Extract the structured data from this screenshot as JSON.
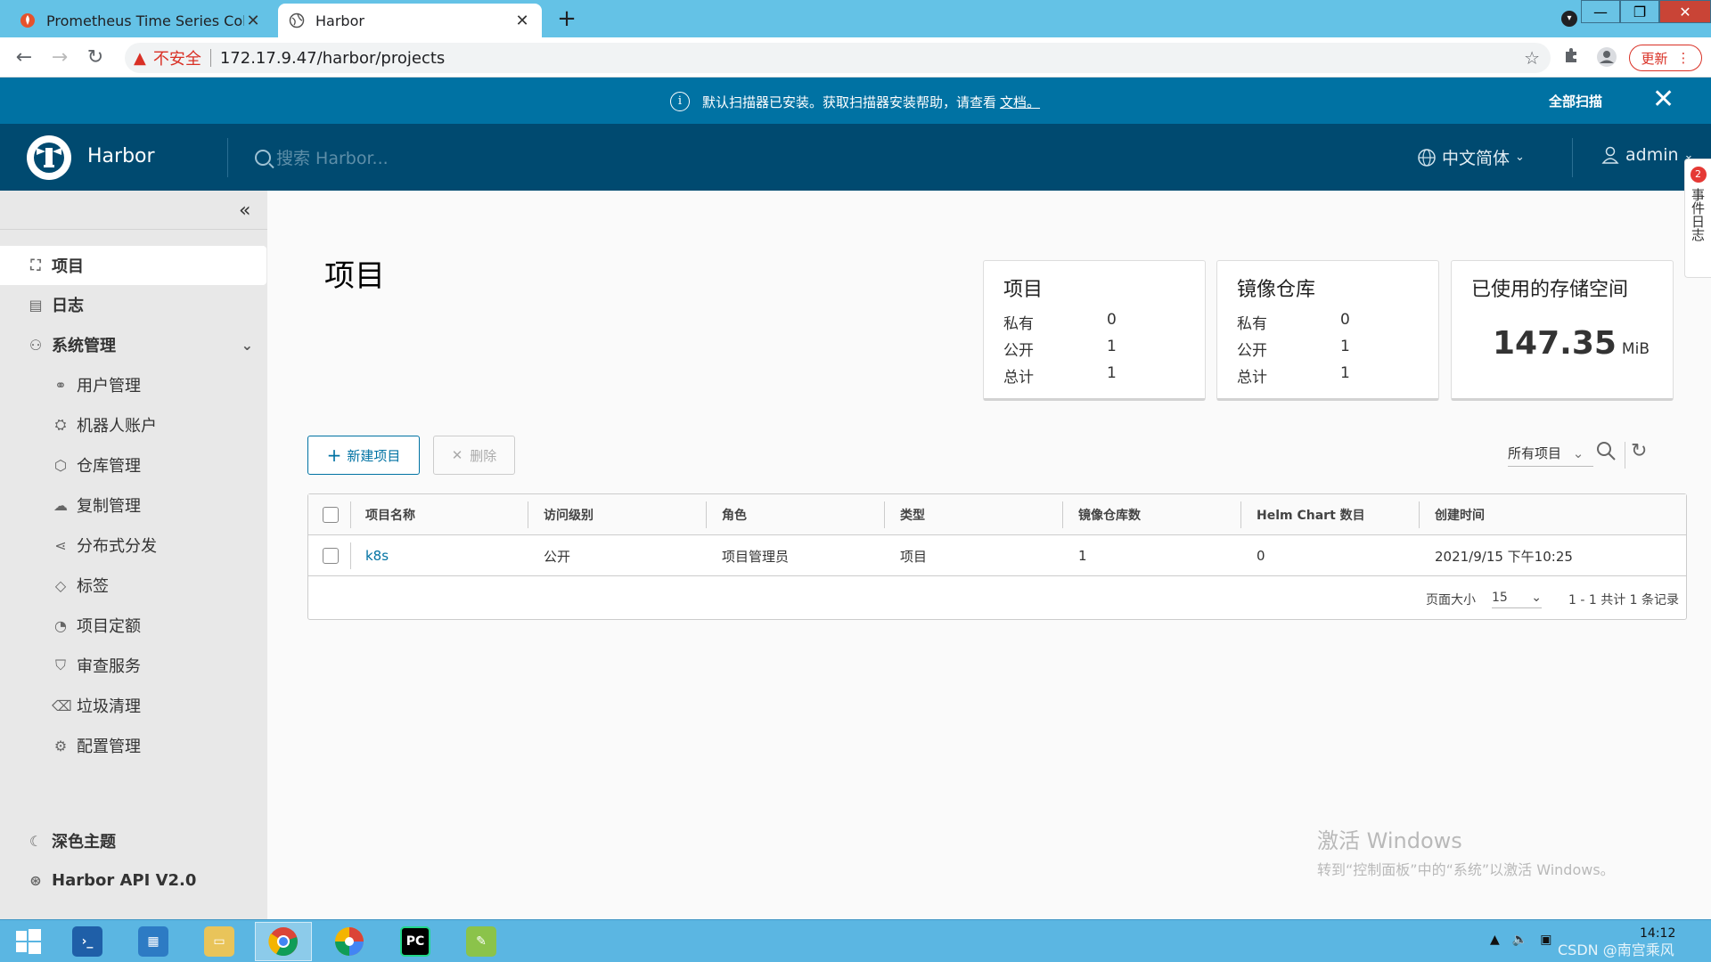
{
  "browser": {
    "tabs": [
      {
        "title": "Prometheus Time Series Colle",
        "active": false,
        "favicon": "prometheus-flame-icon"
      },
      {
        "title": "Harbor",
        "active": true,
        "favicon": "globe-icon"
      }
    ],
    "insecure_label": "不安全",
    "url": "172.17.9.47/harbor/projects",
    "update_label": "更新"
  },
  "banner": {
    "message": "默认扫描器已安装。获取扫描器安装帮助，请查看",
    "link": "文档。",
    "scan_all": "全部扫描"
  },
  "header": {
    "brand": "Harbor",
    "search_placeholder": "搜索 Harbor...",
    "language": "中文简体",
    "user": "admin"
  },
  "sidebar": {
    "items": [
      {
        "label": "项目",
        "icon": "projects-icon",
        "active": true
      },
      {
        "label": "日志",
        "icon": "logs-icon"
      },
      {
        "label": "系统管理",
        "icon": "admin-icon"
      },
      {
        "label": "用户管理",
        "icon": "users-icon"
      },
      {
        "label": "机器人账户",
        "icon": "robot-icon"
      },
      {
        "label": "仓库管理",
        "icon": "registry-icon"
      },
      {
        "label": "复制管理",
        "icon": "replication-icon"
      },
      {
        "label": "分布式分发",
        "icon": "distribution-icon"
      },
      {
        "label": "标签",
        "icon": "tag-icon"
      },
      {
        "label": "项目定额",
        "icon": "quota-icon"
      },
      {
        "label": "审查服务",
        "icon": "interrogation-icon"
      },
      {
        "label": "垃圾清理",
        "icon": "trash-icon"
      },
      {
        "label": "配置管理",
        "icon": "config-gear-icon"
      }
    ],
    "dark_theme": "深色主题",
    "api": "Harbor API V2.0"
  },
  "main": {
    "title": "项目",
    "cards": {
      "projects": {
        "title": "项目",
        "rows": [
          {
            "k": "私有",
            "v": "0"
          },
          {
            "k": "公开",
            "v": "1"
          },
          {
            "k": "总计",
            "v": "1"
          }
        ]
      },
      "repos": {
        "title": "镜像仓库",
        "rows": [
          {
            "k": "私有",
            "v": "0"
          },
          {
            "k": "公开",
            "v": "1"
          },
          {
            "k": "总计",
            "v": "1"
          }
        ]
      },
      "storage": {
        "title": "已使用的存储空间",
        "value": "147.35",
        "unit": "MiB"
      }
    },
    "new_project": "新建项目",
    "delete": "删除",
    "filter": "所有项目",
    "table": {
      "headers": [
        "项目名称",
        "访问级别",
        "角色",
        "类型",
        "镜像仓库数",
        "Helm Chart 数目",
        "创建时间"
      ],
      "rows": [
        [
          "k8s",
          "公开",
          "项目管理员",
          "项目",
          "1",
          "0",
          "2021/9/15 下午10:25"
        ]
      ]
    },
    "page_size_label": "页面大小",
    "page_size": "15",
    "page_info": "1 - 1 共计 1 条记录"
  },
  "float_tab": {
    "badge": "2",
    "label": "事件日志"
  },
  "watermark": {
    "line1": "激活 Windows",
    "line2": "转到“控制面板”中的“系统”以激活 Windows。"
  },
  "taskbar": {
    "time": "14:12",
    "csdn": "CSDN @南宫乘风"
  }
}
